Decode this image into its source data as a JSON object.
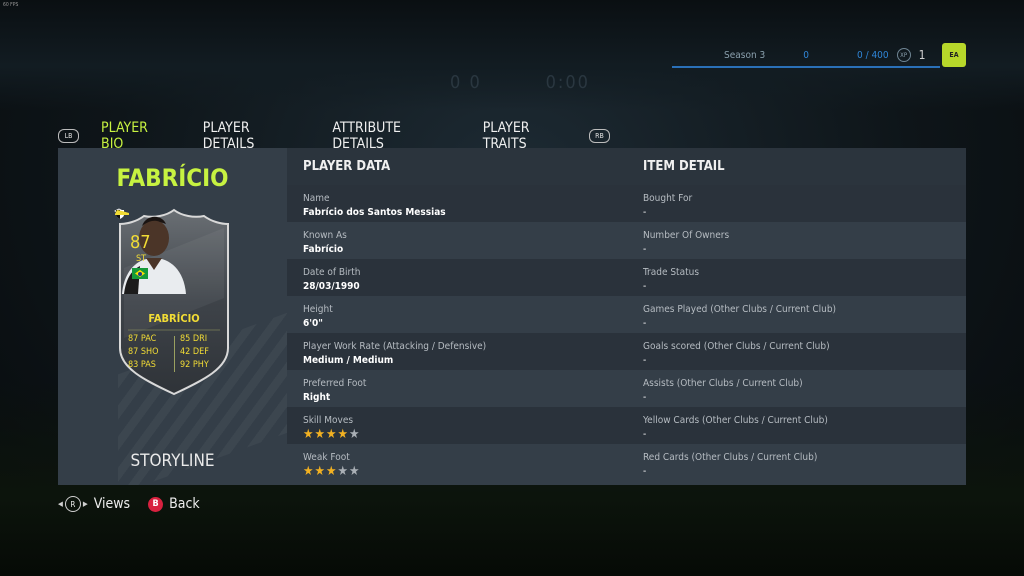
{
  "hud": {
    "fps": "60 FPS",
    "season": "Season 3",
    "level_points": "0",
    "xp": "0 / 400",
    "xp_chip": "XP",
    "level": "1",
    "badge": "EA",
    "score_left": "0 0",
    "score_right": "0:00"
  },
  "tabs": {
    "left_bumper": "LB",
    "right_bumper": "RB",
    "items": [
      {
        "label": "PLAYER BIO",
        "active": true
      },
      {
        "label": "PLAYER DETAILS",
        "active": false
      },
      {
        "label": "ATTRIBUTE DETAILS",
        "active": false
      },
      {
        "label": "PLAYER TRAITS",
        "active": false
      }
    ]
  },
  "player": {
    "name": "FABRÍCIO",
    "tag": "STORYLINE"
  },
  "card": {
    "rating": "87",
    "position": "ST",
    "name": "FABRÍCIO",
    "stats": [
      {
        "value": "87",
        "label": "PAC"
      },
      {
        "value": "85",
        "label": "DRI"
      },
      {
        "value": "87",
        "label": "SHO"
      },
      {
        "value": "42",
        "label": "DEF"
      },
      {
        "value": "83",
        "label": "PAS"
      },
      {
        "value": "92",
        "label": "PHY"
      }
    ],
    "colors": {
      "accent": "#f2dc35",
      "card_bg": "#4a4f55"
    }
  },
  "table": {
    "headers": {
      "player_data": "PLAYER DATA",
      "item_detail": "ITEM DETAIL"
    },
    "rows": [
      {
        "l_label": "Name",
        "l_value": "Fabrício dos Santos Messias",
        "r_label": "Bought For",
        "r_value": "-"
      },
      {
        "l_label": "Known As",
        "l_value": "Fabrício",
        "r_label": "Number Of Owners",
        "r_value": "-"
      },
      {
        "l_label": "Date of Birth",
        "l_value": "28/03/1990",
        "r_label": "Trade Status",
        "r_value": "-"
      },
      {
        "l_label": "Height",
        "l_value": "6'0\"",
        "r_label": "Games Played (Other Clubs / Current Club)",
        "r_value": "-"
      },
      {
        "l_label": "Player Work Rate (Attacking / Defensive)",
        "l_value": "Medium / Medium",
        "r_label": "Goals scored (Other Clubs / Current Club)",
        "r_value": "-"
      },
      {
        "l_label": "Preferred Foot",
        "l_value": "Right",
        "r_label": "Assists (Other Clubs / Current Club)",
        "r_value": "-"
      },
      {
        "l_label": "Skill Moves",
        "l_stars": 4,
        "r_label": "Yellow Cards (Other Clubs / Current Club)",
        "r_value": "-"
      },
      {
        "l_label": "Weak Foot",
        "l_stars": 3,
        "r_label": "Red Cards (Other Clubs / Current Club)",
        "r_value": "-"
      }
    ],
    "star_max": 5
  },
  "footer": {
    "views_button": "R",
    "views_label": "Views",
    "back_button": "B",
    "back_label": "Back"
  },
  "colors": {
    "accent_green": "#c7f241",
    "tab_underline": "#e3264f",
    "star_on": "#f2b122",
    "star_off": "#a9afb5"
  }
}
